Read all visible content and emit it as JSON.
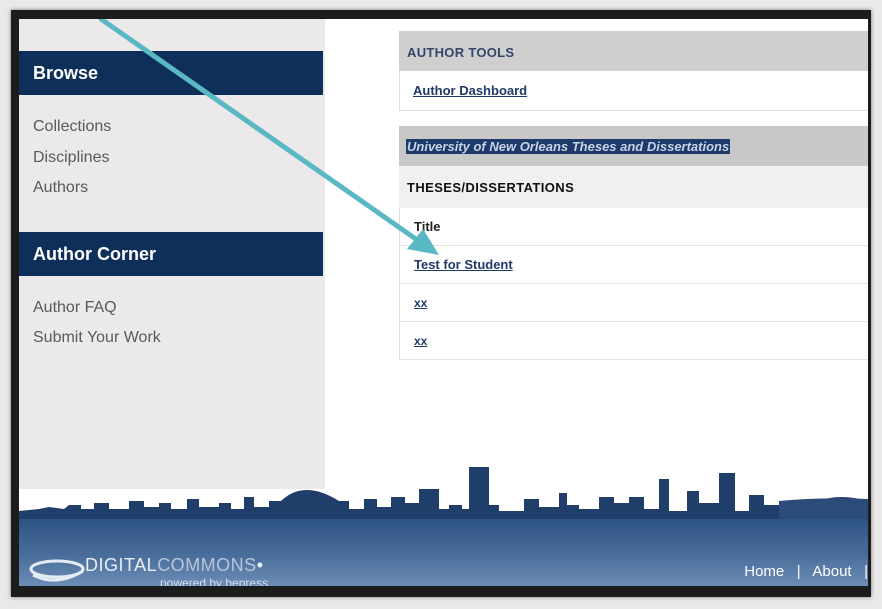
{
  "sidebar": {
    "browse_heading": "Browse",
    "browse_links": [
      "Collections",
      "Disciplines",
      "Authors"
    ],
    "author_corner_heading": "Author Corner",
    "author_links": [
      "Author FAQ",
      "Submit Your Work"
    ]
  },
  "main": {
    "author_tools_heading": "AUTHOR TOOLS",
    "author_dashboard_link": "Author Dashboard",
    "collection_title": "University of New Orleans Theses and Dissertations",
    "section_heading": "THESES/DISSERTATIONS",
    "table": {
      "column_header": "Title",
      "rows": [
        "Test for Student",
        "xx",
        "xx"
      ]
    }
  },
  "footer": {
    "logo_digital": "DIGITAL",
    "logo_commons": "COMMONS",
    "logo_mark": "•",
    "powered_by": "powered by bepress",
    "nav": [
      "Home",
      "About"
    ],
    "separator": "|"
  },
  "colors": {
    "header_navy": "#0e2f5a",
    "arrow_teal": "#5ab8c4",
    "link": "#1f3a66"
  }
}
